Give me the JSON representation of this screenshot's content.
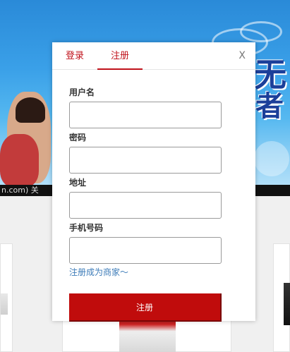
{
  "background": {
    "banner_slogan": "无",
    "banner_slogan2": "者",
    "banner_strip_text": "n.com)  关"
  },
  "modal": {
    "tabs": {
      "login_label": "登录",
      "register_label": "注册"
    },
    "close_label": "X",
    "form": {
      "username_label": "用户名",
      "username_value": "",
      "password_label": "密码",
      "password_value": "",
      "address_label": "地址",
      "address_value": "",
      "phone_label": "手机号码",
      "phone_value": "",
      "merchant_link": "注册成为商家～",
      "submit_label": "注册"
    }
  },
  "colors": {
    "accent": "#c0121b",
    "link": "#3c7bb8",
    "button": "#c00c0c"
  }
}
